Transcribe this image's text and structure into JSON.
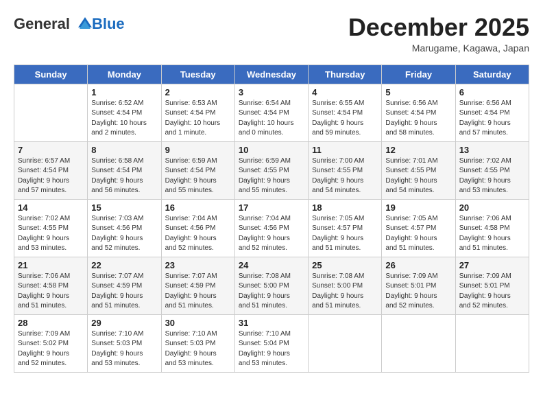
{
  "logo": {
    "general": "General",
    "blue": "Blue"
  },
  "title": "December 2025",
  "subtitle": "Marugame, Kagawa, Japan",
  "days_of_week": [
    "Sunday",
    "Monday",
    "Tuesday",
    "Wednesday",
    "Thursday",
    "Friday",
    "Saturday"
  ],
  "weeks": [
    [
      {
        "day": "",
        "info": ""
      },
      {
        "day": "1",
        "info": "Sunrise: 6:52 AM\nSunset: 4:54 PM\nDaylight: 10 hours\nand 2 minutes."
      },
      {
        "day": "2",
        "info": "Sunrise: 6:53 AM\nSunset: 4:54 PM\nDaylight: 10 hours\nand 1 minute."
      },
      {
        "day": "3",
        "info": "Sunrise: 6:54 AM\nSunset: 4:54 PM\nDaylight: 10 hours\nand 0 minutes."
      },
      {
        "day": "4",
        "info": "Sunrise: 6:55 AM\nSunset: 4:54 PM\nDaylight: 9 hours\nand 59 minutes."
      },
      {
        "day": "5",
        "info": "Sunrise: 6:56 AM\nSunset: 4:54 PM\nDaylight: 9 hours\nand 58 minutes."
      },
      {
        "day": "6",
        "info": "Sunrise: 6:56 AM\nSunset: 4:54 PM\nDaylight: 9 hours\nand 57 minutes."
      }
    ],
    [
      {
        "day": "7",
        "info": "Sunrise: 6:57 AM\nSunset: 4:54 PM\nDaylight: 9 hours\nand 57 minutes."
      },
      {
        "day": "8",
        "info": "Sunrise: 6:58 AM\nSunset: 4:54 PM\nDaylight: 9 hours\nand 56 minutes."
      },
      {
        "day": "9",
        "info": "Sunrise: 6:59 AM\nSunset: 4:54 PM\nDaylight: 9 hours\nand 55 minutes."
      },
      {
        "day": "10",
        "info": "Sunrise: 6:59 AM\nSunset: 4:55 PM\nDaylight: 9 hours\nand 55 minutes."
      },
      {
        "day": "11",
        "info": "Sunrise: 7:00 AM\nSunset: 4:55 PM\nDaylight: 9 hours\nand 54 minutes."
      },
      {
        "day": "12",
        "info": "Sunrise: 7:01 AM\nSunset: 4:55 PM\nDaylight: 9 hours\nand 54 minutes."
      },
      {
        "day": "13",
        "info": "Sunrise: 7:02 AM\nSunset: 4:55 PM\nDaylight: 9 hours\nand 53 minutes."
      }
    ],
    [
      {
        "day": "14",
        "info": "Sunrise: 7:02 AM\nSunset: 4:55 PM\nDaylight: 9 hours\nand 53 minutes."
      },
      {
        "day": "15",
        "info": "Sunrise: 7:03 AM\nSunset: 4:56 PM\nDaylight: 9 hours\nand 52 minutes."
      },
      {
        "day": "16",
        "info": "Sunrise: 7:04 AM\nSunset: 4:56 PM\nDaylight: 9 hours\nand 52 minutes."
      },
      {
        "day": "17",
        "info": "Sunrise: 7:04 AM\nSunset: 4:56 PM\nDaylight: 9 hours\nand 52 minutes."
      },
      {
        "day": "18",
        "info": "Sunrise: 7:05 AM\nSunset: 4:57 PM\nDaylight: 9 hours\nand 51 minutes."
      },
      {
        "day": "19",
        "info": "Sunrise: 7:05 AM\nSunset: 4:57 PM\nDaylight: 9 hours\nand 51 minutes."
      },
      {
        "day": "20",
        "info": "Sunrise: 7:06 AM\nSunset: 4:58 PM\nDaylight: 9 hours\nand 51 minutes."
      }
    ],
    [
      {
        "day": "21",
        "info": "Sunrise: 7:06 AM\nSunset: 4:58 PM\nDaylight: 9 hours\nand 51 minutes."
      },
      {
        "day": "22",
        "info": "Sunrise: 7:07 AM\nSunset: 4:59 PM\nDaylight: 9 hours\nand 51 minutes."
      },
      {
        "day": "23",
        "info": "Sunrise: 7:07 AM\nSunset: 4:59 PM\nDaylight: 9 hours\nand 51 minutes."
      },
      {
        "day": "24",
        "info": "Sunrise: 7:08 AM\nSunset: 5:00 PM\nDaylight: 9 hours\nand 51 minutes."
      },
      {
        "day": "25",
        "info": "Sunrise: 7:08 AM\nSunset: 5:00 PM\nDaylight: 9 hours\nand 51 minutes."
      },
      {
        "day": "26",
        "info": "Sunrise: 7:09 AM\nSunset: 5:01 PM\nDaylight: 9 hours\nand 52 minutes."
      },
      {
        "day": "27",
        "info": "Sunrise: 7:09 AM\nSunset: 5:01 PM\nDaylight: 9 hours\nand 52 minutes."
      }
    ],
    [
      {
        "day": "28",
        "info": "Sunrise: 7:09 AM\nSunset: 5:02 PM\nDaylight: 9 hours\nand 52 minutes."
      },
      {
        "day": "29",
        "info": "Sunrise: 7:10 AM\nSunset: 5:03 PM\nDaylight: 9 hours\nand 53 minutes."
      },
      {
        "day": "30",
        "info": "Sunrise: 7:10 AM\nSunset: 5:03 PM\nDaylight: 9 hours\nand 53 minutes."
      },
      {
        "day": "31",
        "info": "Sunrise: 7:10 AM\nSunset: 5:04 PM\nDaylight: 9 hours\nand 53 minutes."
      },
      {
        "day": "",
        "info": ""
      },
      {
        "day": "",
        "info": ""
      },
      {
        "day": "",
        "info": ""
      }
    ]
  ]
}
